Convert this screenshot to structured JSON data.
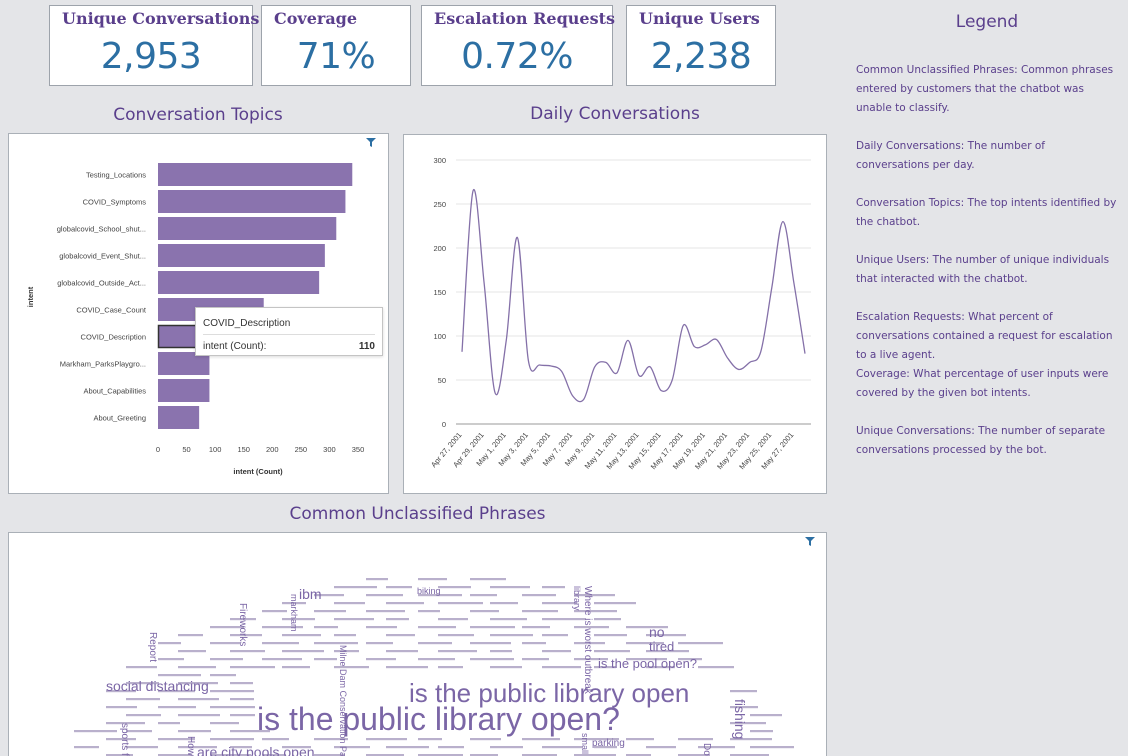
{
  "kpis": [
    {
      "title": "Unique Conversations",
      "value": "2,953"
    },
    {
      "title": "Coverage",
      "value": "71%"
    },
    {
      "title": "Escalation Requests",
      "value": "0.72%"
    },
    {
      "title": "Unique Users",
      "value": "2,238"
    }
  ],
  "sections": {
    "topics": "Conversation Topics",
    "daily": "Daily Conversations",
    "phrases": "Common Unclassified Phrases"
  },
  "legend": {
    "title": "Legend",
    "items": [
      "Common Unclassified Phrases: Common phrases entered by customers that the chatbot was unable to classify.",
      "Daily Conversations: The number of conversations per day.",
      "Conversation Topics: The top intents identified by the chatbot.",
      "Unique Users: The number of unique individuals that interacted with the chatbot.",
      "Escalation Requests: What percent of conversations contained a request for escalation to a live agent.",
      "Coverage: What percentage of user inputs were covered by the given bot intents.",
      "Unique Conversations: The number of separate conversations processed by the bot."
    ]
  },
  "tooltip": {
    "title": "COVID_Description",
    "label": "intent (Count):",
    "value": "110"
  },
  "colors": {
    "accent": "#5a3f8c",
    "bar": "#8a73ae",
    "kpi_value": "#2c6fa3",
    "line": "#8470a8"
  },
  "chart_data": [
    {
      "type": "bar",
      "orientation": "horizontal",
      "categories": [
        "Testing_Locations",
        "COVID_Symptoms",
        "globalcovid_School_shut...",
        "globalcovid_Event_Shut...",
        "globalcovid_Outside_Act...",
        "COVID_Case_Count",
        "COVID_Description",
        "Markham_ParksPlaygro...",
        "About_Capabilities",
        "About_Greeting"
      ],
      "values": [
        340,
        328,
        312,
        292,
        282,
        185,
        110,
        90,
        90,
        72
      ],
      "xlabel": "intent (Count)",
      "ylabel": "intent",
      "xlim": [
        0,
        350
      ],
      "xticks": [
        "0",
        "50",
        "100",
        "150",
        "200",
        "250",
        "300",
        "350"
      ]
    },
    {
      "type": "line",
      "x": [
        "Apr 27, 2001",
        "Apr 28, 2001",
        "Apr 29, 2001",
        "Apr 30, 2001",
        "May 1, 2001",
        "May 2, 2001",
        "May 3, 2001",
        "May 4, 2001",
        "May 5, 2001",
        "May 6, 2001",
        "May 7, 2001",
        "May 8, 2001",
        "May 9, 2001",
        "May 10, 2001",
        "May 11, 2001",
        "May 12, 2001",
        "May 13, 2001",
        "May 14, 2001",
        "May 15, 2001",
        "May 16, 2001",
        "May 17, 2001",
        "May 18, 2001",
        "May 19, 2001",
        "May 20, 2001",
        "May 21, 2001",
        "May 22, 2001",
        "May 23, 2001",
        "May 24, 2001",
        "May 25, 2001",
        "May 26, 2001",
        "May 27, 2001",
        "May 28, 2001"
      ],
      "values": [
        82,
        265,
        160,
        35,
        95,
        212,
        72,
        67,
        66,
        60,
        32,
        28,
        65,
        70,
        58,
        95,
        55,
        65,
        38,
        50,
        112,
        88,
        90,
        96,
        75,
        62,
        70,
        82,
        155,
        230,
        160,
        80
      ],
      "xticks": [
        "Apr 27, 2001",
        "Apr 29, 2001",
        "May 1, 2001",
        "May 3, 2001",
        "May 5, 2001",
        "May 7, 2001",
        "May 9, 2001",
        "May 11, 2001",
        "May 13, 2001",
        "May 15, 2001",
        "May 17, 2001",
        "May 19, 2001",
        "May 21, 2001",
        "May 23, 2001",
        "May 25, 2001",
        "May 27, 2001"
      ],
      "ylim": [
        0,
        300
      ],
      "yticks": [
        "0",
        "50",
        "100",
        "150",
        "200",
        "250",
        "300"
      ]
    }
  ],
  "wordcloud": {
    "words": [
      "is the public library open?",
      "is the public library open",
      "social distancing",
      "is the pool open?",
      "are city pools open",
      "ibm",
      "biking",
      "no",
      "tired",
      "parking",
      "fishing",
      "markham",
      "Fireworks",
      "Report",
      "Milne Dam Conservation Park",
      "Where is worst outbreak",
      "library",
      "sports fields",
      "How",
      "small",
      "Do"
    ]
  }
}
